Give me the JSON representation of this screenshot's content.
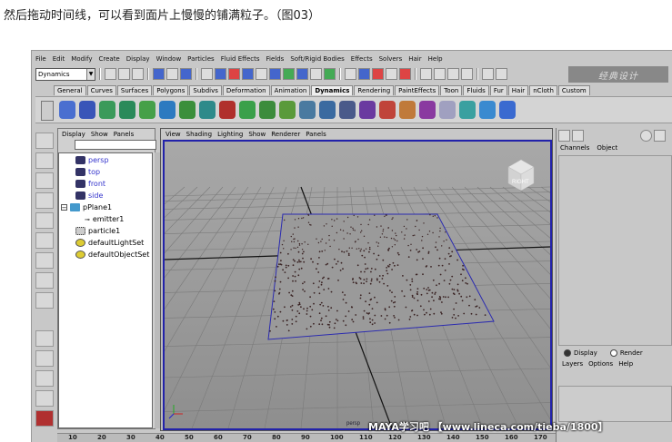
{
  "caption": "然后拖动时间线，可以看到面片上慢慢的铺满粒子。（图03）",
  "menu": [
    "File",
    "Edit",
    "Modify",
    "Create",
    "Display",
    "Window",
    "Particles",
    "Fluid Effects",
    "Fields",
    "Soft/Rigid Bodies",
    "Effects",
    "Solvers",
    "Hair",
    "Help"
  ],
  "mode_select": "Dynamics",
  "logo_text": "经典设计",
  "shelf_tabs": [
    "General",
    "Curves",
    "Surfaces",
    "Polygons",
    "Subdivs",
    "Deformation",
    "Animation",
    "Dynamics",
    "Rendering",
    "PaintEffects",
    "Toon",
    "Fluids",
    "Fur",
    "Hair",
    "nCloth",
    "Custom"
  ],
  "active_tab": "Dynamics",
  "outliner": {
    "menu": [
      "Display",
      "Show",
      "Panels"
    ],
    "items": [
      "persp",
      "top",
      "front",
      "side",
      "pPlane1",
      "emitter1",
      "particle1",
      "defaultLightSet",
      "defaultObjectSet"
    ]
  },
  "viewport": {
    "menu": [
      "View",
      "Shading",
      "Lighting",
      "Show",
      "Renderer",
      "Panels"
    ],
    "cube_label": "RIGHT",
    "plane_label": "persp"
  },
  "channel_box": {
    "tabs": [
      "Channels",
      "Object"
    ]
  },
  "layers": {
    "radio_display": "Display",
    "radio_render": "Render",
    "menu": [
      "Layers",
      "Options",
      "Help"
    ]
  },
  "timeline": {
    "ticks": [
      "10",
      "20",
      "30",
      "40",
      "50",
      "60",
      "70",
      "80",
      "90",
      "100",
      "110",
      "120",
      "130",
      "140",
      "150",
      "160",
      "170"
    ]
  },
  "watermark": "MAYA学习吧 【www.lineca.com/tieba/1800】"
}
